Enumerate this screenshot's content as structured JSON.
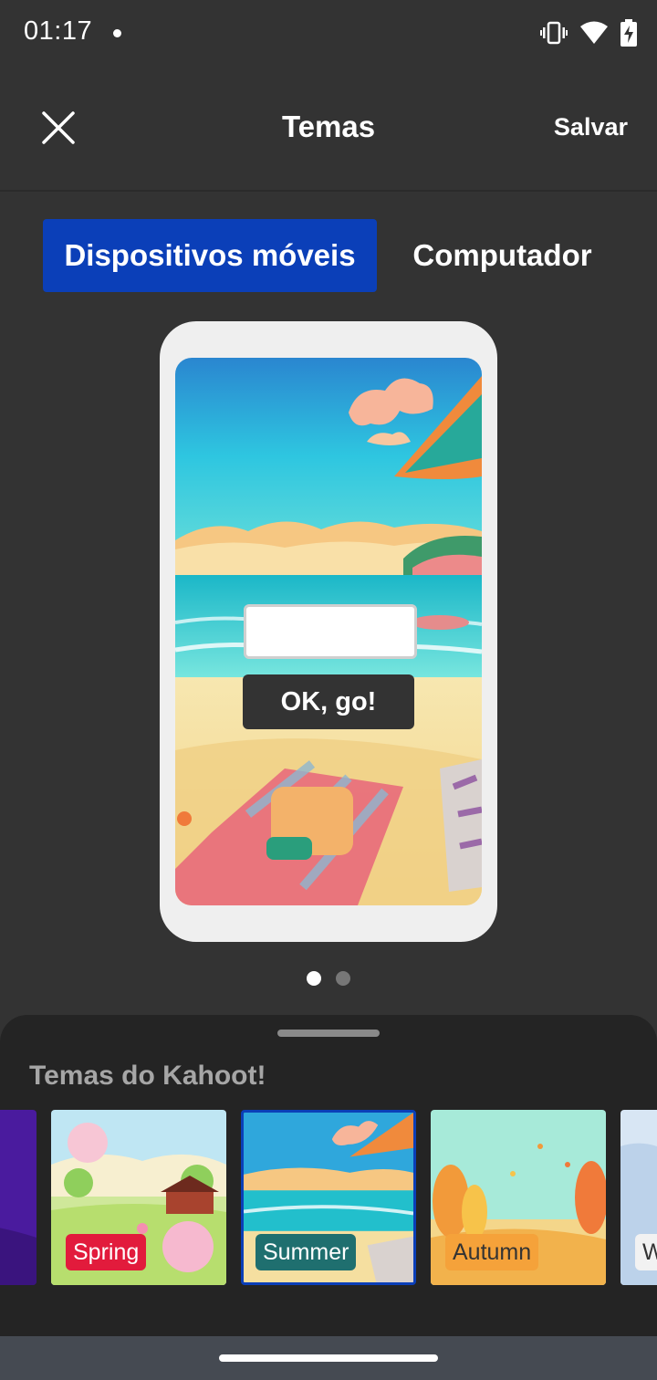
{
  "status_bar": {
    "time": "01:17",
    "icons": [
      "vibrate-icon",
      "wifi-icon",
      "battery-charging-icon"
    ]
  },
  "header": {
    "title": "Temas",
    "save_label": "Salvar",
    "close_icon": "close-icon"
  },
  "tabs": [
    {
      "label": "Dispositivos móveis",
      "selected": true
    },
    {
      "label": "Computador",
      "selected": false
    }
  ],
  "preview": {
    "pin_input_value": "",
    "button_label": "OK, go!",
    "page_count": 2,
    "current_page": 1
  },
  "themes_sheet": {
    "title": "Temas do Kahoot!",
    "themes": [
      {
        "label": "Spring",
        "label_bg": "#e21b3c",
        "label_color": "#ffffff"
      },
      {
        "label": "Summer",
        "label_bg": "#1f6f6f",
        "label_color": "#ffffff",
        "selected": true
      },
      {
        "label": "Autumn",
        "label_bg": "#f5a23a",
        "label_color": "#333333"
      },
      {
        "label": "W",
        "label_bg": "#f2f2f2",
        "label_color": "#333333"
      }
    ]
  },
  "colors": {
    "accent": "#0b3fb8",
    "background": "#333333",
    "sheet_background": "#242424"
  }
}
